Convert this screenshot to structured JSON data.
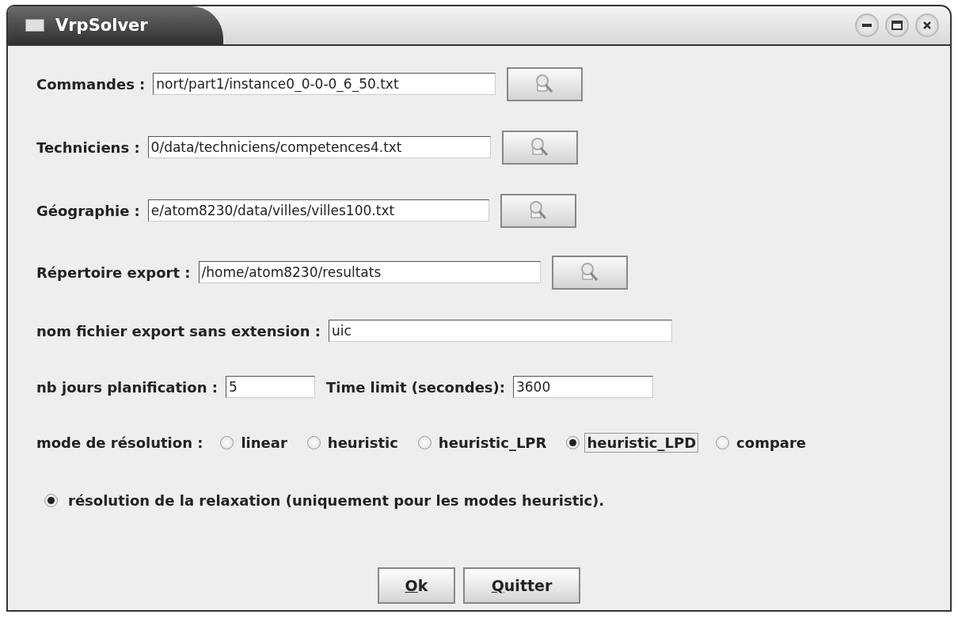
{
  "window": {
    "title": "VrpSolver"
  },
  "file_fields": [
    {
      "label": "Commandes :",
      "value": "nort/part1/instance0_0-0-0_6_50.txt"
    },
    {
      "label": "Techniciens :",
      "value": "0/data/techniciens/competences4.txt"
    },
    {
      "label": "Géographie :",
      "value": "e/atom8230/data/villes/villes100.txt"
    },
    {
      "label": "Répertoire export :",
      "value": "/home/atom8230/resultats"
    }
  ],
  "export_name": {
    "label": "nom fichier export sans extension :",
    "value": "uic"
  },
  "days": {
    "label": "nb jours planification :",
    "value": "5"
  },
  "time_limit": {
    "label": "Time limit (secondes):",
    "value": "3600"
  },
  "mode": {
    "label": "mode de résolution :",
    "options": [
      {
        "label": "linear",
        "selected": false
      },
      {
        "label": "heuristic",
        "selected": false
      },
      {
        "label": "heuristic_LPR",
        "selected": false
      },
      {
        "label": "heuristic_LPD",
        "selected": true
      },
      {
        "label": "compare",
        "selected": false
      }
    ]
  },
  "relaxation": {
    "label": "résolution de la relaxation (uniquement pour les modes heuristic).",
    "checked": true
  },
  "buttons": [
    "Ok",
    "Quitter"
  ]
}
